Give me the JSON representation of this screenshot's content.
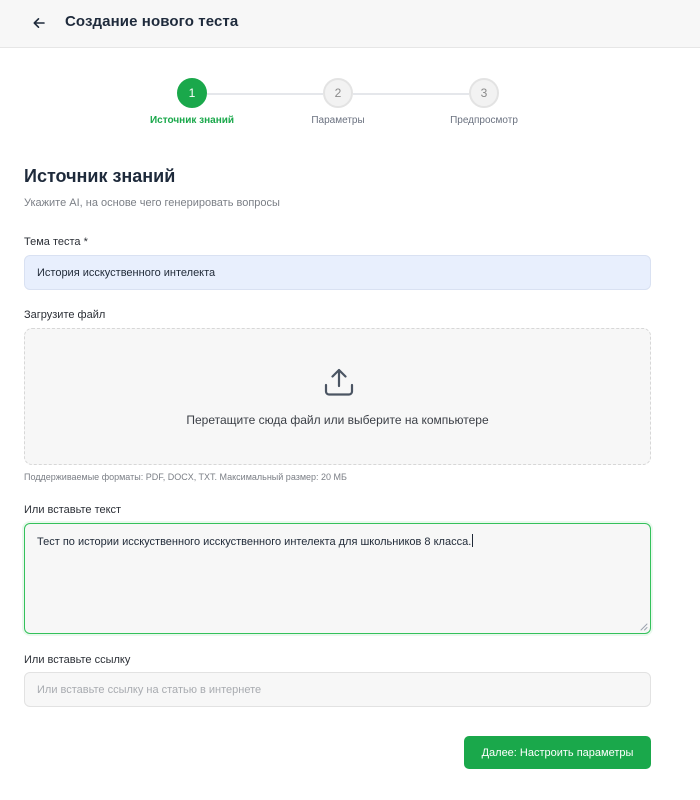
{
  "header": {
    "back_icon": "arrow-left-icon",
    "title": "Создание нового теста"
  },
  "stepper": {
    "steps": [
      {
        "number": "1",
        "label": "Источник знаний",
        "state": "active"
      },
      {
        "number": "2",
        "label": "Параметры",
        "state": "inactive"
      },
      {
        "number": "3",
        "label": "Предпросмотр",
        "state": "inactive"
      }
    ],
    "active_color": "#1aa84b"
  },
  "section": {
    "title": "Источник знаний",
    "subtitle": "Укажите AI, на основе чего генерировать вопросы"
  },
  "topic": {
    "label": "Тема теста *",
    "value": "История исскуственного интелекта"
  },
  "upload": {
    "label": "Загрузите файл",
    "icon": "upload-icon",
    "prompt": "Перетащите сюда файл или выберите на компьютере",
    "hint": "Поддерживаемые форматы: PDF, DOCX, TXT. Максимальный размер: 20 МБ"
  },
  "paste_text": {
    "label": "Или вставьте текст",
    "value": "Тест по истории исскуственного исскуственного интелекта для школьников 8 класса."
  },
  "paste_link": {
    "label": "Или вставьте ссылку",
    "placeholder": "Или вставьте ссылку на статью в интернете"
  },
  "actions": {
    "next_label": "Далее: Настроить параметры"
  }
}
